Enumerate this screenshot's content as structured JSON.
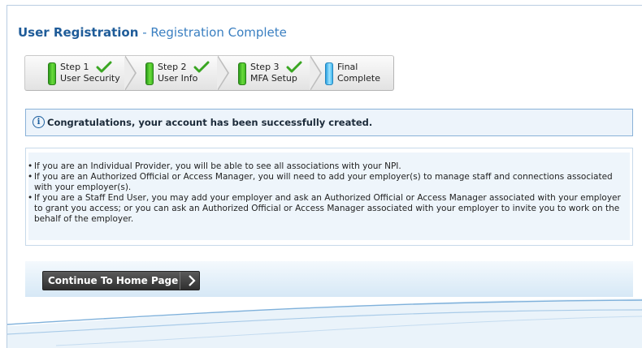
{
  "header": {
    "title": "User Registration",
    "separator": " - ",
    "subtitle": "Registration Complete"
  },
  "steps": [
    {
      "line1": "Step 1",
      "line2": "User Security",
      "status": "complete",
      "indicator_color": "#4cc52b"
    },
    {
      "line1": "Step 2",
      "line2": "User Info",
      "status": "complete",
      "indicator_color": "#4cc52b"
    },
    {
      "line1": "Step 3",
      "line2": "MFA Setup",
      "status": "complete",
      "indicator_color": "#4cc52b"
    },
    {
      "line1": "Final",
      "line2": "Complete",
      "status": "current",
      "indicator_color": "#4ec0f0"
    }
  ],
  "info": {
    "icon": "info-icon",
    "message": "Congratulations, your account has been successfully created."
  },
  "notes": [
    "If you are an Individual Provider, you will be able to see all associations with your NPI.",
    "If you are an Authorized Official or Access Manager, you will need to add your employer(s) to manage staff and connections associated with your employer(s).",
    "If you are a Staff End User, you may add your employer and ask an Authorized Official or Access Manager associated with your employer to grant you access; or you can ask an Authorized Official or Access Manager associated with your employer to invite you to work on the behalf of the employer."
  ],
  "actions": {
    "continue_label": "Continue To Home Page",
    "continue_icon": "chevron-right-icon"
  },
  "colors": {
    "title": "#1f5c99",
    "check": "#3aa622",
    "button": "#3d3d3d",
    "info_border": "#8ab2d8"
  }
}
